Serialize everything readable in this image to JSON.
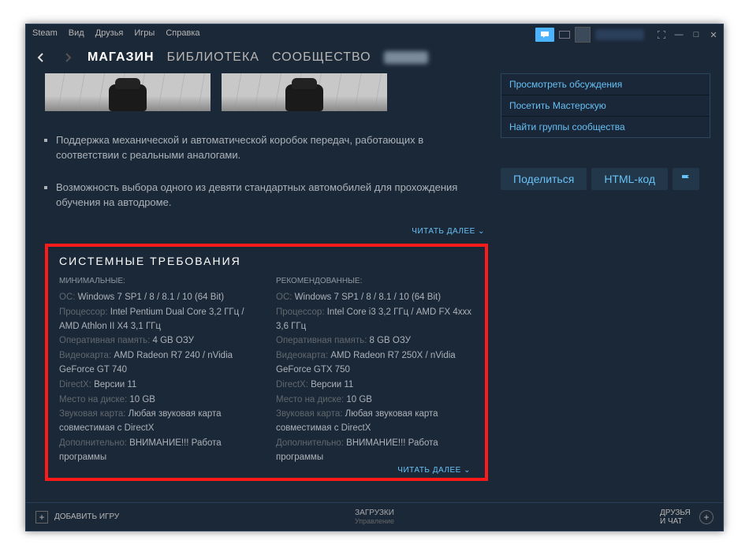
{
  "menubar": {
    "items": [
      "Steam",
      "Вид",
      "Друзья",
      "Игры",
      "Справка"
    ]
  },
  "nav": {
    "store": "МАГАЗИН",
    "library": "БИБЛИОТЕКА",
    "community": "СООБЩЕСТВО"
  },
  "bullets": [
    "Поддержка механической и автоматической коробок передач, работающих в соответствии с реальными аналогами.",
    "Возможность выбора одного из девяти стандартных автомобилей для прохождения обучения на автодроме."
  ],
  "readmore": "ЧИТАТЬ ДАЛЕЕ",
  "req": {
    "title": "СИСТЕМНЫЕ ТРЕБОВАНИЯ",
    "min": {
      "hdr": "МИНИМАЛЬНЫЕ:",
      "os_k": "ОС:",
      "os_v": "Windows 7 SP1 / 8 / 8.1 / 10 (64 Bit)",
      "cpu_k": "Процессор:",
      "cpu_v": "Intel Pentium Dual Core 3,2 ГГц / AMD Athlon II X4 3,1 ГГц",
      "ram_k": "Оперативная память:",
      "ram_v": "4 GB ОЗУ",
      "gpu_k": "Видеокарта:",
      "gpu_v": "AMD Radeon R7 240 / nVidia GeForce GT 740",
      "dx_k": "DirectX:",
      "dx_v": "Версии 11",
      "disk_k": "Место на диске:",
      "disk_v": "10 GB",
      "snd_k": "Звуковая карта:",
      "snd_v": "Любая звуковая карта совместимая с DirectX",
      "add_k": "Дополнительно:",
      "add_v": "ВНИМАНИЕ!!! Работа программы"
    },
    "rec": {
      "hdr": "РЕКОМЕНДОВАННЫЕ:",
      "os_k": "ОС:",
      "os_v": "Windows 7 SP1 / 8 / 8.1 / 10 (64 Bit)",
      "cpu_k": "Процессор:",
      "cpu_v": "Intel Core i3 3,2 ГГц / AMD FX 4xxx 3,6 ГГц",
      "ram_k": "Оперативная память:",
      "ram_v": "8 GB ОЗУ",
      "gpu_k": "Видеокарта:",
      "gpu_v": "AMD Radeon R7 250X / nVidia GeForce GTX 750",
      "dx_k": "DirectX:",
      "dx_v": "Версии 11",
      "disk_k": "Место на диске:",
      "disk_v": "10 GB",
      "snd_k": "Звуковая карта:",
      "snd_v": "Любая звуковая карта совместимая с DirectX",
      "add_k": "Дополнительно:",
      "add_v": "ВНИМАНИЕ!!! Работа программы"
    }
  },
  "side": {
    "links": [
      "Просмотреть обсуждения",
      "Посетить Мастерскую",
      "Найти группы сообщества"
    ],
    "share": "Поделиться",
    "html": "HTML-код"
  },
  "footer": {
    "addgame": "ДОБАВИТЬ ИГРУ",
    "downloads": "ЗАГРУЗКИ",
    "manage": "Управление",
    "friends": "ДРУЗЬЯ И ЧАТ"
  }
}
